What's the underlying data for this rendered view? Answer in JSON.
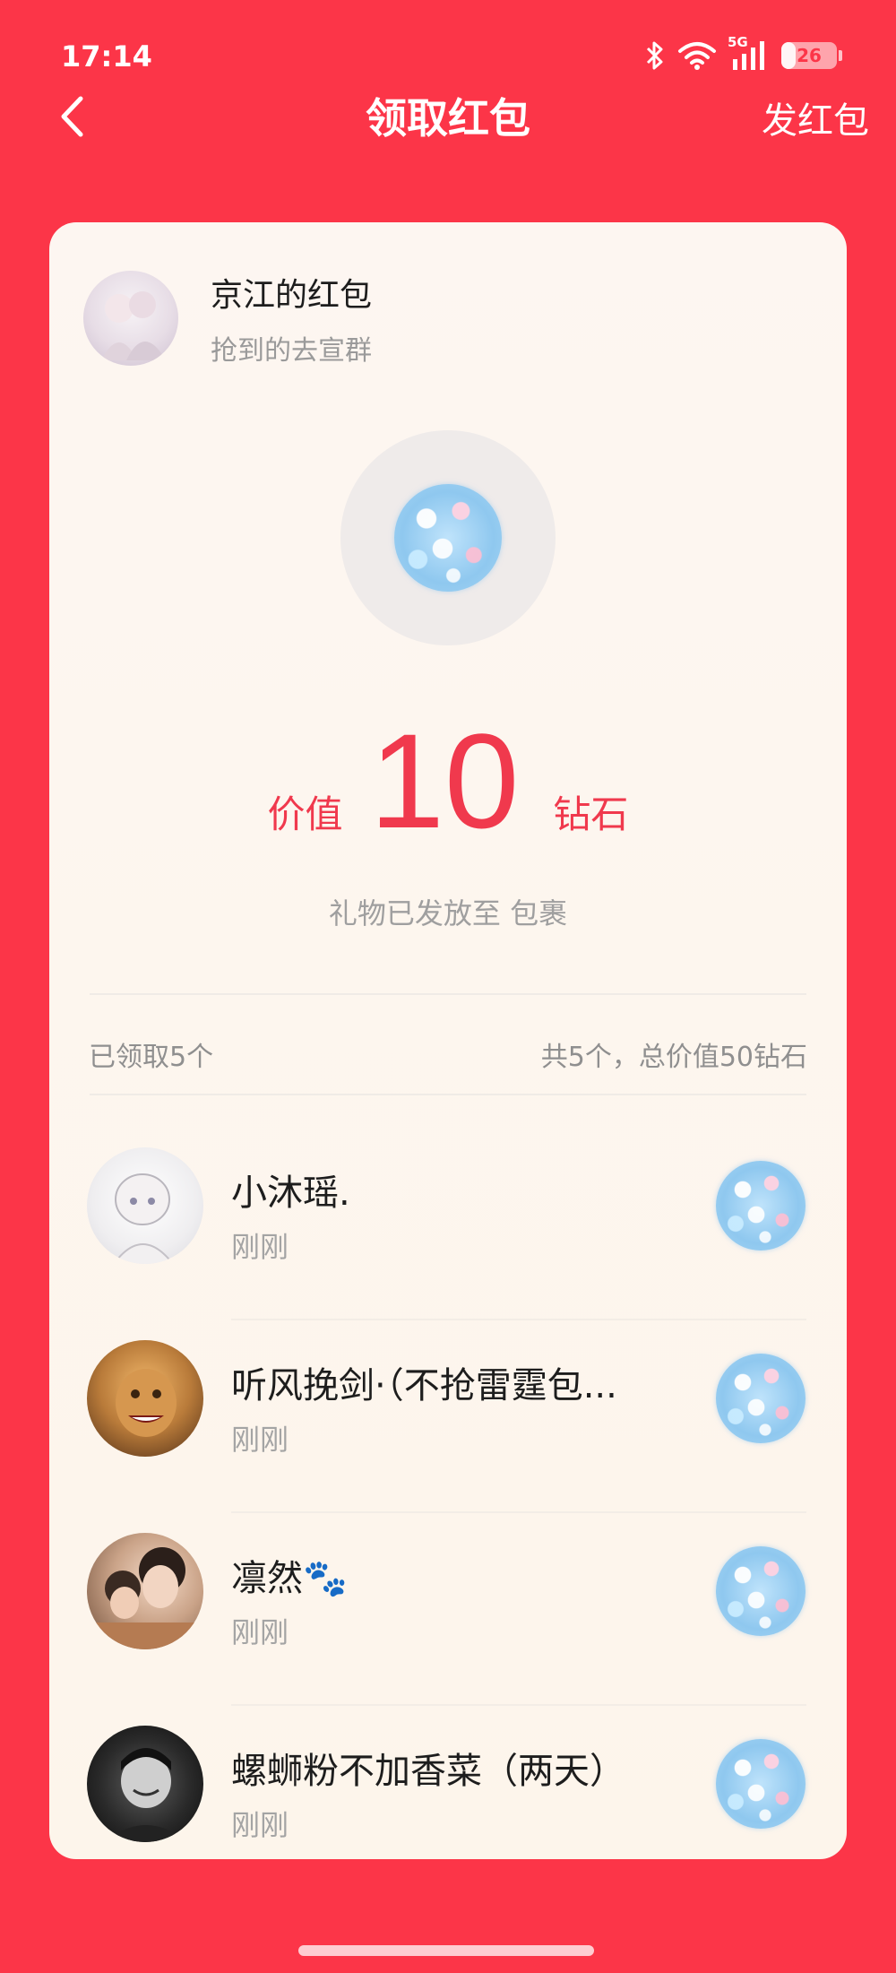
{
  "status_bar": {
    "time": "17:14",
    "network": "5G",
    "battery": "26",
    "battery_level": 0.26
  },
  "nav": {
    "title": "领取红包",
    "action": "发红包"
  },
  "sender": {
    "name": "京江的红包",
    "subtitle": "抢到的去宣群"
  },
  "gift": {
    "value_label": "价值",
    "value": "10",
    "unit": "钻石",
    "delivered_text": "礼物已发放至 包裹"
  },
  "summary": {
    "claimed": "已领取5个",
    "total": "共5个，总价值50钻石"
  },
  "claims": [
    {
      "name": "小沐瑶.",
      "time": "刚刚"
    },
    {
      "name": "听风挽剑·（不抢雷霆包...",
      "time": "刚刚"
    },
    {
      "name": "凛然🐾",
      "time": "刚刚"
    },
    {
      "name": "螺蛳粉不加香菜（两天）",
      "time": "刚刚"
    }
  ],
  "colors": {
    "background": "#fc3548",
    "accent": "#f0394d",
    "card": "#fdf6f1"
  },
  "icons": {
    "back": "chevron-left-icon",
    "bluetooth": "bluetooth-icon",
    "wifi": "wifi-icon",
    "signal": "signal-icon",
    "battery": "battery-icon",
    "gift": "diamond-gift-icon"
  }
}
